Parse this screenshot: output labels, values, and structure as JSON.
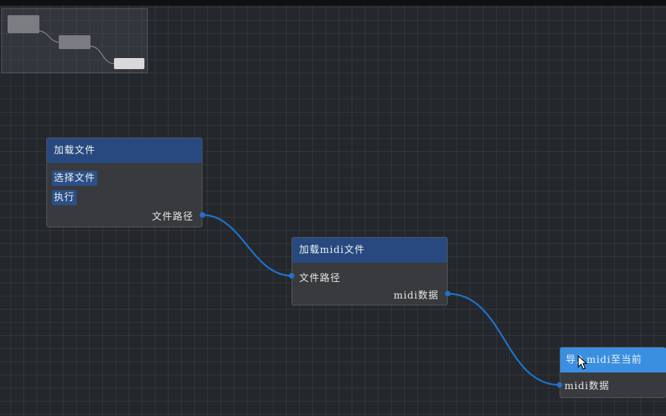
{
  "minimap": {
    "nodes": [
      "node-1",
      "node-2",
      "node-3"
    ]
  },
  "nodes": {
    "load_file": {
      "title": "加载文件",
      "buttons": {
        "select_file": "选择文件",
        "execute": "执行"
      },
      "outputs": {
        "file_path": "文件路径"
      }
    },
    "load_midi": {
      "title": "加载midi文件",
      "inputs": {
        "file_path": "文件路径"
      },
      "outputs": {
        "midi_data": "midi数据"
      }
    },
    "import_midi": {
      "title": "导入midi至当前",
      "inputs": {
        "midi_data": "midi数据"
      }
    }
  },
  "colors": {
    "canvas": "#24272c",
    "node_body": "#383a3e",
    "node_header": "#27497f",
    "node_header_selected": "#3b8fe0",
    "edge": "#1f72c8"
  },
  "icons": {
    "cursor": "pointer-cursor-icon"
  }
}
